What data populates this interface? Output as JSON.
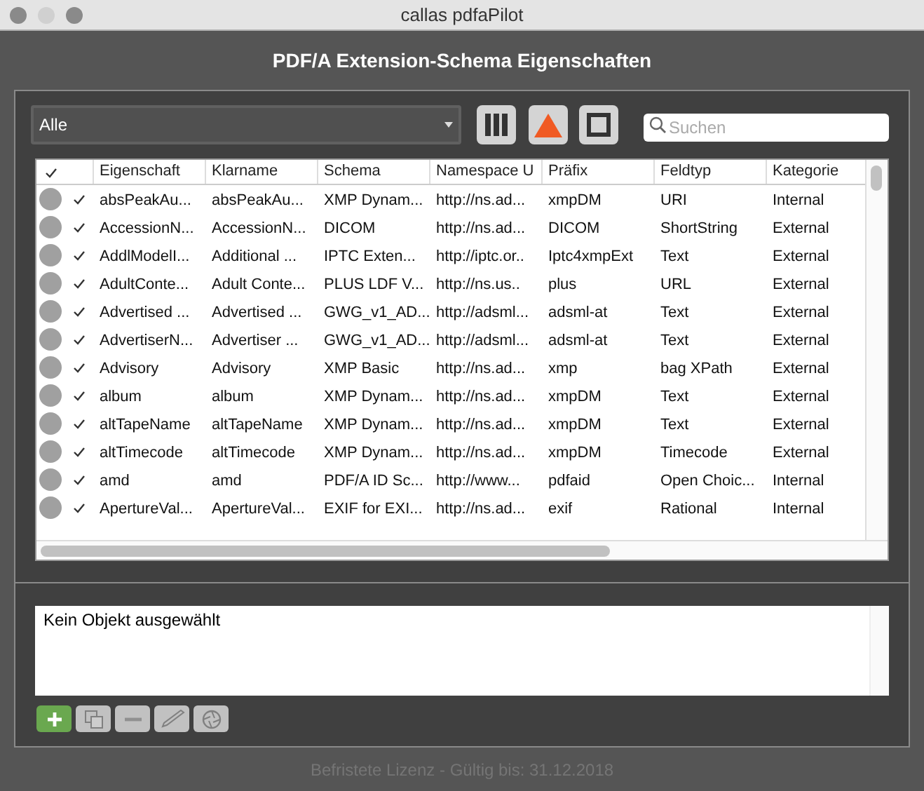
{
  "window": {
    "title": "callas pdfaPilot"
  },
  "heading": "PDF/A Extension-Schema Eigenschaften",
  "filter": {
    "value": "Alle"
  },
  "search": {
    "placeholder": "Suchen"
  },
  "table": {
    "header_checked": true,
    "columns": [
      "Eigenschaft",
      "Klarname",
      "Schema",
      "Namespace U",
      "Präfix",
      "Feldtyp",
      "Kategorie"
    ],
    "rows": [
      {
        "checked": true,
        "cells": [
          "absPeakAu...",
          "absPeakAu...",
          "XMP Dynam...",
          "http://ns.ad...",
          "xmpDM",
          "URI",
          "Internal"
        ]
      },
      {
        "checked": true,
        "cells": [
          "AccessionN...",
          "AccessionN...",
          "DICOM",
          "http://ns.ad...",
          "DICOM",
          "ShortString",
          "External"
        ]
      },
      {
        "checked": true,
        "cells": [
          "AddlModelI...",
          "Additional ...",
          "IPTC Exten...",
          "http://iptc.or..",
          "Iptc4xmpExt",
          "Text",
          "External"
        ]
      },
      {
        "checked": true,
        "cells": [
          "AdultConte...",
          "Adult Conte...",
          "PLUS LDF V...",
          "http://ns.us..",
          "plus",
          "URL",
          "External"
        ]
      },
      {
        "checked": true,
        "cells": [
          "Advertised ...",
          "Advertised ...",
          "GWG_v1_AD...",
          "http://adsml...",
          "adsml-at",
          "Text",
          "External"
        ]
      },
      {
        "checked": true,
        "cells": [
          "AdvertiserN...",
          "Advertiser ...",
          "GWG_v1_AD...",
          "http://adsml...",
          "adsml-at",
          "Text",
          "External"
        ]
      },
      {
        "checked": true,
        "cells": [
          "Advisory",
          "Advisory",
          "XMP Basic",
          "http://ns.ad...",
          "xmp",
          "bag XPath",
          "External"
        ]
      },
      {
        "checked": true,
        "cells": [
          "album",
          "album",
          "XMP Dynam...",
          "http://ns.ad...",
          "xmpDM",
          "Text",
          "External"
        ]
      },
      {
        "checked": true,
        "cells": [
          "altTapeName",
          "altTapeName",
          "XMP Dynam...",
          "http://ns.ad...",
          "xmpDM",
          "Text",
          "External"
        ]
      },
      {
        "checked": true,
        "cells": [
          "altTimecode",
          "altTimecode",
          "XMP Dynam...",
          "http://ns.ad...",
          "xmpDM",
          "Timecode",
          "External"
        ]
      },
      {
        "checked": true,
        "cells": [
          "amd",
          "amd",
          "PDF/A ID Sc...",
          "http://www...",
          "pdfaid",
          "Open Choic...",
          "Internal"
        ]
      },
      {
        "checked": true,
        "cells": [
          "ApertureVal...",
          "ApertureVal...",
          "EXIF for EXI...",
          "http://ns.ad...",
          "exif",
          "Rational",
          "Internal"
        ]
      }
    ]
  },
  "details": {
    "text": "Kein Objekt ausgewählt"
  },
  "buttons": [
    {
      "kind": "add",
      "disabled": false
    },
    {
      "kind": "duplicate",
      "disabled": true
    },
    {
      "kind": "remove",
      "disabled": true
    },
    {
      "kind": "edit",
      "disabled": true
    },
    {
      "kind": "aperture",
      "disabled": true
    }
  ],
  "status_bar": "Befristete Lizenz - Gültig bis: 31.12.2018"
}
